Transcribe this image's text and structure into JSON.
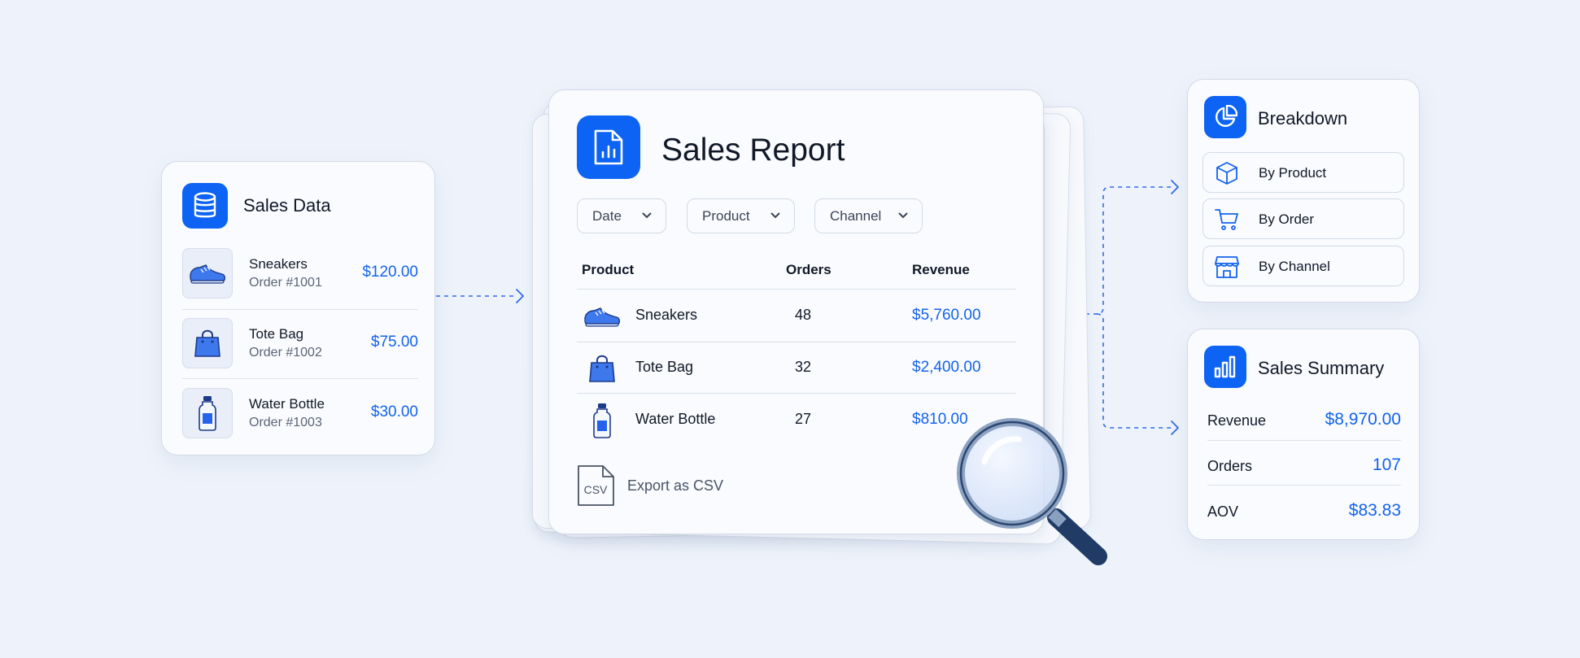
{
  "sales_data": {
    "title": "Sales Data",
    "icon": "database-icon",
    "items": [
      {
        "name": "Sneakers",
        "order": "Order #1001",
        "price": "$120.00",
        "icon": "sneaker-icon"
      },
      {
        "name": "Tote Bag",
        "order": "Order #1002",
        "price": "$75.00",
        "icon": "tote-bag-icon"
      },
      {
        "name": "Water Bottle",
        "order": "Order #1003",
        "price": "$30.00",
        "icon": "water-bottle-icon"
      }
    ]
  },
  "report": {
    "title": "Sales Report",
    "icon": "report-document-icon",
    "filters": [
      "Date",
      "Product",
      "Channel"
    ],
    "columns": [
      "Product",
      "Orders",
      "Revenue"
    ],
    "rows": [
      {
        "product": "Sneakers",
        "orders": "48",
        "revenue": "$5,760.00",
        "icon": "sneaker-icon"
      },
      {
        "product": "Tote Bag",
        "orders": "32",
        "revenue": "$2,400.00",
        "icon": "tote-bag-icon"
      },
      {
        "product": "Water Bottle",
        "orders": "27",
        "revenue": "$810.00",
        "icon": "water-bottle-icon"
      }
    ],
    "export_label": "Export as CSV",
    "export_icon_text": "CSV"
  },
  "breakdown": {
    "title": "Breakdown",
    "icon": "pie-chart-icon",
    "items": [
      {
        "label": "By Product",
        "icon": "box-icon"
      },
      {
        "label": "By Order",
        "icon": "cart-icon"
      },
      {
        "label": "By Channel",
        "icon": "storefront-icon"
      }
    ]
  },
  "summary": {
    "title": "Sales Summary",
    "icon": "bar-chart-icon",
    "rows": [
      {
        "label": "Revenue",
        "value": "$8,970.00"
      },
      {
        "label": "Orders",
        "value": "107"
      },
      {
        "label": "AOV",
        "value": "$83.83"
      }
    ]
  },
  "colors": {
    "background": "#eef3fb",
    "accent": "#0d63f3",
    "value_text": "#1463ec",
    "card": "#f9fbfe"
  }
}
